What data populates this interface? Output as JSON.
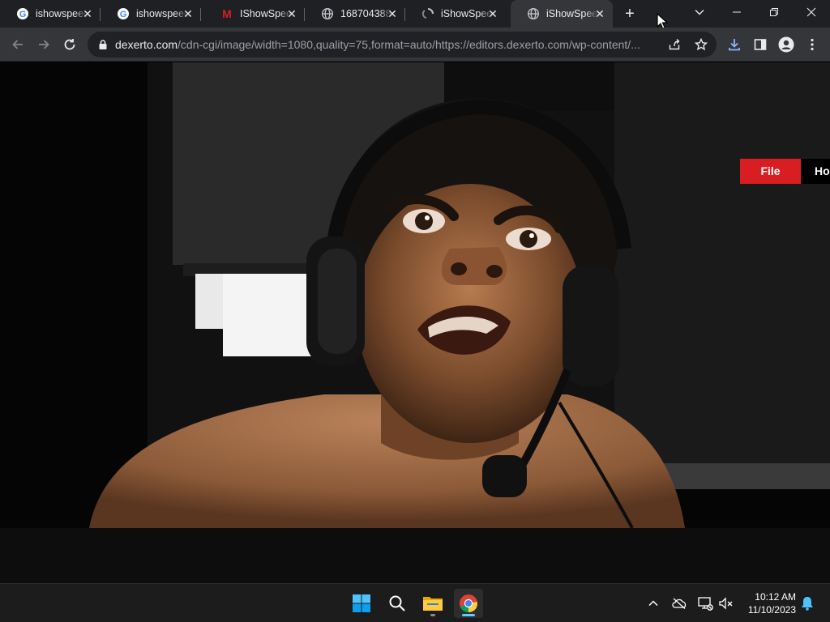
{
  "tabs": [
    {
      "title": "ishowspeed",
      "favicon": "google-icon",
      "active": false
    },
    {
      "title": "ishowspeed",
      "favicon": "google-icon",
      "active": false
    },
    {
      "title": "IShowSpeed",
      "favicon": "m-logo-icon",
      "active": false
    },
    {
      "title": "1687043888",
      "favicon": "globe-icon",
      "active": false
    },
    {
      "title": "iShowSpeed",
      "favicon": "loading-spinner-icon",
      "active": false
    },
    {
      "title": "iShowSpeed",
      "favicon": "globe-icon",
      "active": true
    }
  ],
  "toolbar": {
    "url_host": "dexerto.com",
    "url_path": "/cdn-cgi/image/width=1080,quality=75,format=auto/https://editors.dexerto.com/wp-content/..."
  },
  "page": {
    "buttons": [
      "File",
      "Ho"
    ],
    "image_content": "photo of shirtless man wearing black headset with microphone, making a grimacing face"
  },
  "taskbar": {
    "apps": [
      "start-icon",
      "search-icon",
      "file-explorer-icon",
      "chrome-icon"
    ],
    "time": "10:12 AM",
    "date": "11/10/2023"
  },
  "colors": {
    "tabstrip": "#1f2023",
    "toolbar": "#35363a",
    "omnibox": "#202124",
    "red_button": "#d81e22",
    "taskbar": "#1c1c1c"
  }
}
